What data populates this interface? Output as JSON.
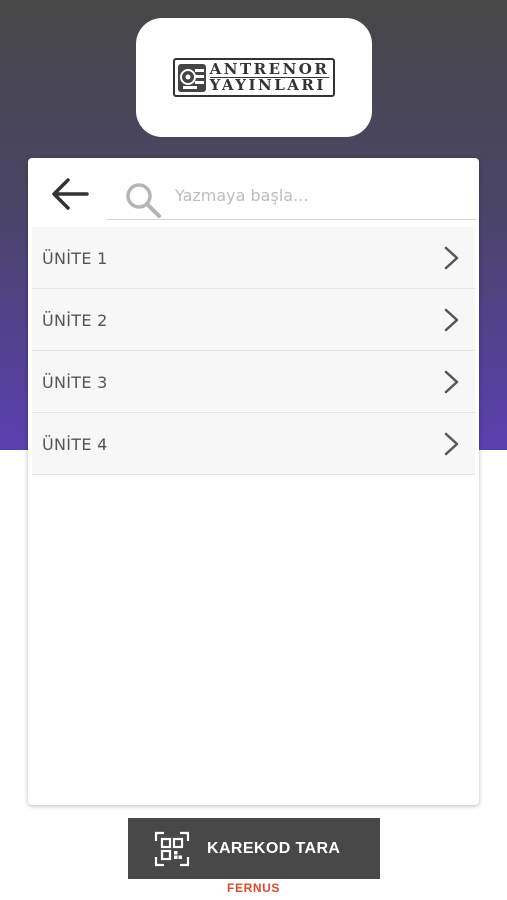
{
  "header": {
    "logo_line1": "ANTRENOR",
    "logo_line2": "YAYINLARI",
    "gradient_top": "#474747",
    "gradient_bottom": "#5a3fb0"
  },
  "toolbar": {
    "back_icon": "arrow-left-icon"
  },
  "search": {
    "placeholder": "Yazmaya başla...",
    "value": "",
    "icon": "search-icon"
  },
  "units": [
    {
      "label": "ÜNİTE 1"
    },
    {
      "label": "ÜNİTE 2"
    },
    {
      "label": "ÜNİTE 3"
    },
    {
      "label": "ÜNİTE 4"
    }
  ],
  "footer": {
    "qr_button_label": "KAREKOD TARA",
    "qr_icon": "qr-scan-icon",
    "brand": "FERNUS",
    "brand_color": "#e0492b"
  }
}
